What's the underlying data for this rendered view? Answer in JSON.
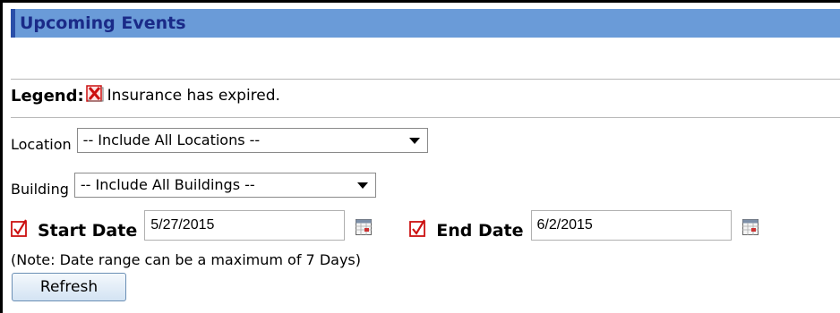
{
  "header": {
    "title": "Upcoming Events"
  },
  "legend": {
    "label": "Legend:",
    "text": "Insurance has expired.",
    "icon": "red-x-icon"
  },
  "filters": {
    "location": {
      "label": "Location",
      "selected": "-- Include All Locations --"
    },
    "building": {
      "label": "Building",
      "selected": "-- Include All Buildings --"
    }
  },
  "dates": {
    "start": {
      "label": "Start Date",
      "value": "5/27/2015",
      "checked": true
    },
    "end": {
      "label": "End Date",
      "value": "6/2/2015",
      "checked": true
    }
  },
  "note": "(Note: Date range can be a maximum of 7 Days)",
  "refresh_label": "Refresh",
  "colors": {
    "header_bg": "#6a9bd8",
    "header_text": "#1a2a88",
    "check_red": "#cc1111",
    "button_border": "#6b8fb5"
  }
}
